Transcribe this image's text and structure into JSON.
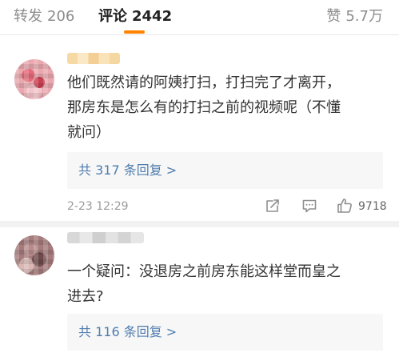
{
  "tabs": {
    "repost": {
      "label": "转发",
      "count": "206"
    },
    "comments": {
      "label": "评论",
      "count": "2442"
    },
    "likes": {
      "label": "赞",
      "count": "5.7万"
    }
  },
  "comments": [
    {
      "text_lines": [
        "他们既然请的阿姨打扫，打扫完了才离开，",
        "那房东是怎么有的打扫之前的视频呢（不懂",
        "就问）"
      ],
      "replies": "共 317 条回复 >",
      "timestamp": "2-23 12:29",
      "likes": "9718"
    },
    {
      "text_lines": [
        "一个疑问：没退房之前房东能这样堂而皇之",
        "进去?"
      ],
      "replies": "共 116 条回复 >"
    }
  ],
  "colors": {
    "accent": "#ff8200",
    "link": "#507daf",
    "muted": "#9b9b9b"
  },
  "icons": [
    "share-icon",
    "reply-icon",
    "like-icon"
  ]
}
